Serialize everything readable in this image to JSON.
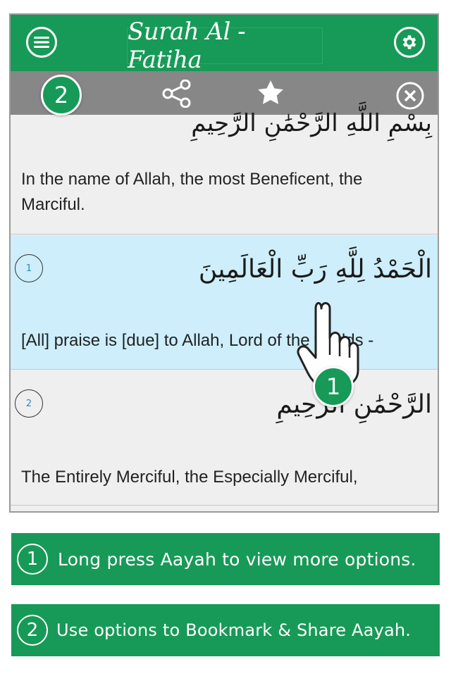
{
  "app_bar": {
    "title": "Surah Al - Fatiha",
    "menu_icon": "hamburger-menu-icon",
    "settings_icon": "gear-icon",
    "color": "#179a57"
  },
  "action_bar": {
    "share_icon": "share-icon",
    "bookmark_icon": "star-icon",
    "close_icon": "close-icon",
    "color": "#878787"
  },
  "verses": [
    {
      "number": "",
      "arabic": "بِسْمِ اللَّهِ الرَّحْمَٰنِ الرَّحِيمِ",
      "translation": "In the name of Allah, the most Beneficent, the Marciful."
    },
    {
      "number": "1",
      "arabic": "الْحَمْدُ لِلَّهِ رَبِّ الْعَالَمِينَ",
      "translation": "[All] praise is [due] to Allah, Lord of the worlds -",
      "selected": true,
      "highlight_color": "#cdeefa"
    },
    {
      "number": "2",
      "arabic": "الرَّحْمَٰنِ الرَّحِيمِ",
      "translation": "The Entirely Merciful, the Especially Merciful,"
    }
  ],
  "callouts": {
    "badge_1": "1",
    "badge_2": "2"
  },
  "tips": [
    {
      "number": "1",
      "text": "Long press Aayah to view more options."
    },
    {
      "number": "2",
      "text": "Use options to Bookmark & Share Aayah."
    }
  ]
}
